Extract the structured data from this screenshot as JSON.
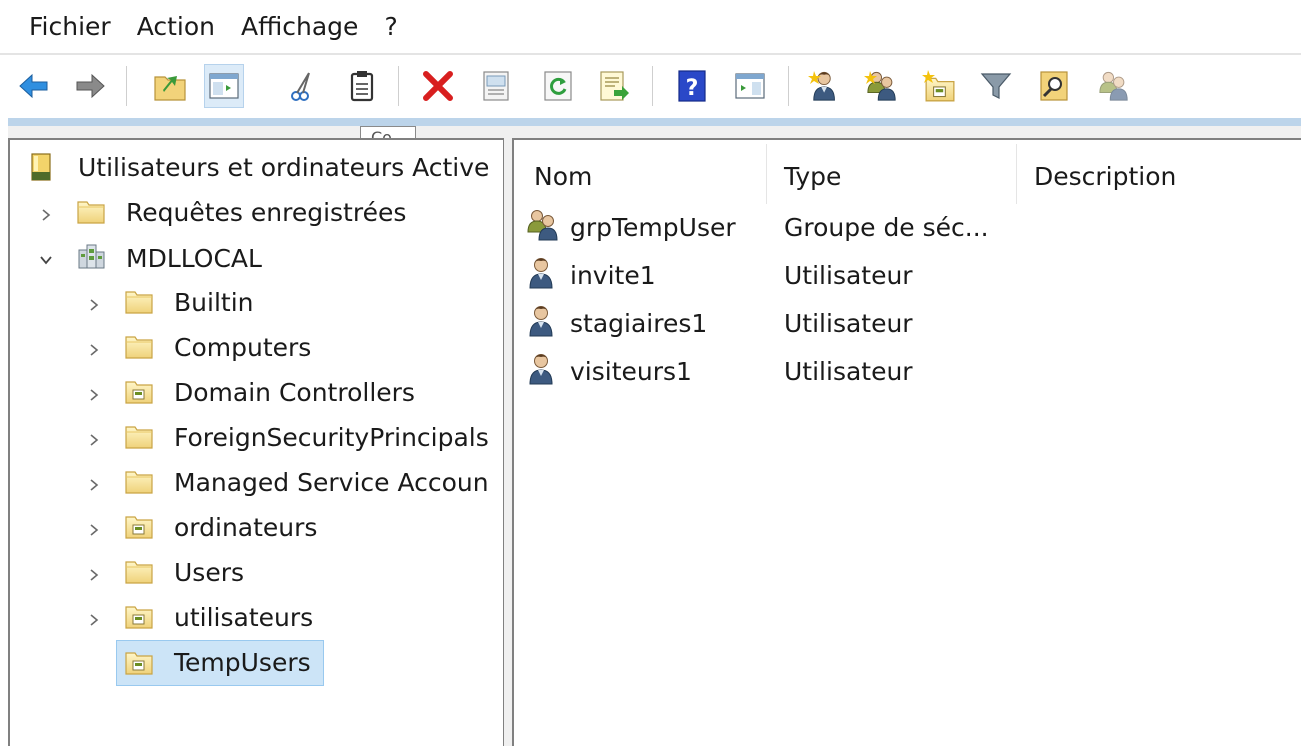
{
  "menu": [
    "Fichier",
    "Action",
    "Affichage",
    "?"
  ],
  "toolbar": {
    "icons": [
      "back-arrow-icon",
      "forward-arrow-icon",
      "up-folder-icon",
      "show-console-tree-icon",
      "cut-icon",
      "paste-icon",
      "delete-icon",
      "properties-icon",
      "refresh-icon",
      "export-list-icon",
      "help-icon",
      "action-pane-icon",
      "new-user-icon",
      "new-group-icon",
      "new-ou-icon",
      "filter-icon",
      "find-icon",
      "add-to-group-icon"
    ],
    "tooltip_fragment": "Co"
  },
  "tree": {
    "root": "Utilisateurs et ordinateurs Active",
    "saved_queries": "Requêtes enregistrées",
    "domain": "MDLLOCAL",
    "children": [
      "Builtin",
      "Computers",
      "Domain Controllers",
      "ForeignSecurityPrincipals",
      "Managed Service Accoun",
      "ordinateurs",
      "Users",
      "utilisateurs",
      "TempUsers"
    ],
    "selected": "TempUsers"
  },
  "list": {
    "columns": [
      "Nom",
      "Type",
      "Description"
    ],
    "rows": [
      {
        "name": "grpTempUser",
        "type": "Groupe de séc...",
        "icon": "group-icon"
      },
      {
        "name": "invite1",
        "type": "Utilisateur",
        "icon": "user-icon"
      },
      {
        "name": "stagiaires1",
        "type": "Utilisateur",
        "icon": "user-icon"
      },
      {
        "name": "visiteurs1",
        "type": "Utilisateur",
        "icon": "user-icon"
      }
    ]
  },
  "colors": {
    "selection_bg": "#cce4f7",
    "selection_border": "#99c9ef",
    "band": "#bcd4ea"
  }
}
